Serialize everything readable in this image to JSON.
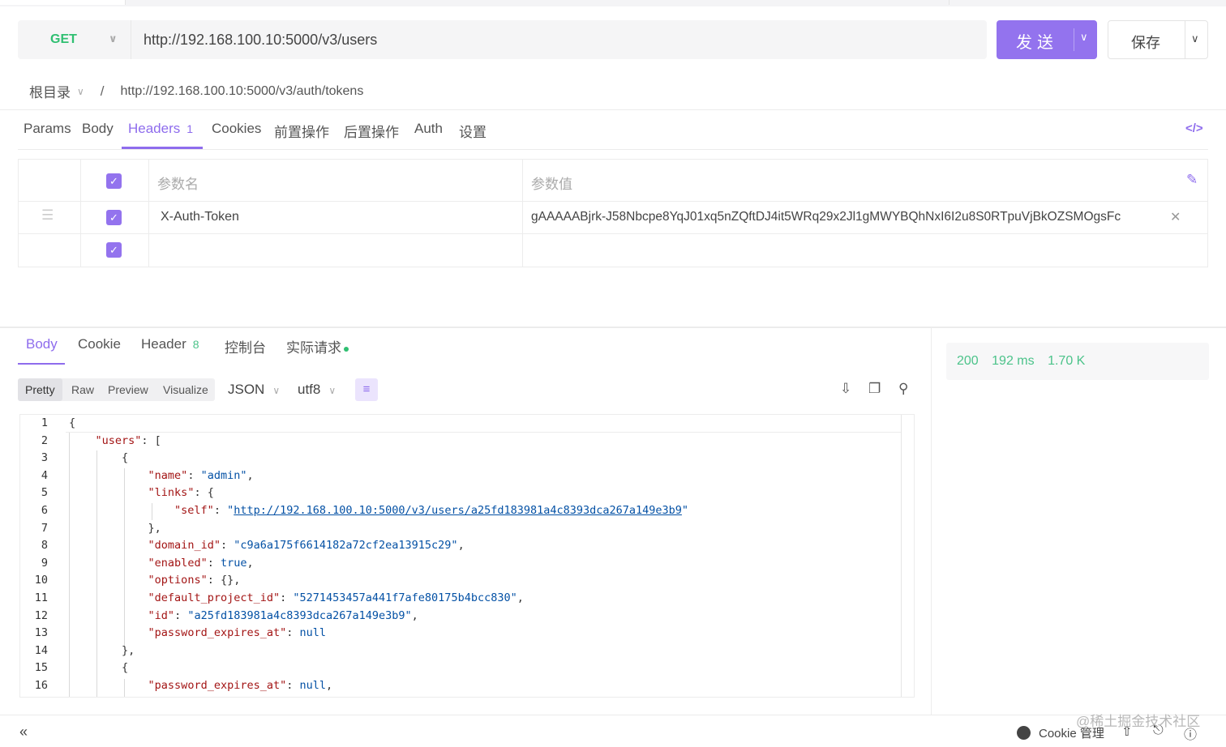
{
  "request": {
    "method": "GET",
    "url": "http://192.168.100.10:5000/v3/users",
    "send_label": "发送",
    "save_label": "保存"
  },
  "breadcrumb": {
    "root": "根目录",
    "separator": "/",
    "path": "http://192.168.100.10:5000/v3/auth/tokens"
  },
  "request_tabs": [
    {
      "label": "Params"
    },
    {
      "label": "Body"
    },
    {
      "label": "Headers",
      "badge": "1"
    },
    {
      "label": "Cookies"
    },
    {
      "label": "前置操作"
    },
    {
      "label": "后置操作"
    },
    {
      "label": "Auth"
    },
    {
      "label": "设置"
    }
  ],
  "headers_table": {
    "name_placeholder": "参数名",
    "value_placeholder": "参数值",
    "rows": [
      {
        "name": "X-Auth-Token",
        "value": "gAAAAABjrk-J58Nbcpe8YqJ01xq5nZQftDJ4it5WRq29x2Jl1gMWYBQhNxI6I2u8S0RTpuVjBkOZSMOgsFc"
      }
    ]
  },
  "response_tabs": [
    {
      "label": "Body"
    },
    {
      "label": "Cookie"
    },
    {
      "label": "Header",
      "badge": "8"
    },
    {
      "label": "控制台"
    },
    {
      "label": "实际请求"
    }
  ],
  "view_modes": [
    "Pretty",
    "Raw",
    "Preview",
    "Visualize"
  ],
  "format": "JSON",
  "encoding": "utf8",
  "status": {
    "code": "200",
    "time": "192 ms",
    "size": "1.70 K"
  },
  "code_lines": [
    {
      "n": "1"
    },
    {
      "n": "2"
    },
    {
      "n": "3"
    },
    {
      "n": "4"
    },
    {
      "n": "5"
    },
    {
      "n": "6"
    },
    {
      "n": "7"
    },
    {
      "n": "8"
    },
    {
      "n": "9"
    },
    {
      "n": "10"
    },
    {
      "n": "11"
    },
    {
      "n": "12"
    },
    {
      "n": "13"
    },
    {
      "n": "14"
    },
    {
      "n": "15"
    },
    {
      "n": "16"
    }
  ],
  "json": {
    "users_key": "\"users\"",
    "name_key": "\"name\"",
    "name_val": "\"admin\"",
    "links_key": "\"links\"",
    "self_key": "\"self\"",
    "self_val": "http://192.168.100.10:5000/v3/users/a25fd183981a4c8393dca267a149e3b9",
    "domain_key": "\"domain_id\"",
    "domain_val": "\"c9a6a175f6614182a72cf2ea13915c29\"",
    "enabled_key": "\"enabled\"",
    "enabled_val": "true",
    "options_key": "\"options\"",
    "options_val": "{}",
    "project_key": "\"default_project_id\"",
    "project_val": "\"5271453457a441f7afe80175b4bcc830\"",
    "id_key": "\"id\"",
    "id_val": "\"a25fd183981a4c8393dca267a149e3b9\"",
    "pw_key": "\"password_expires_at\"",
    "pw_val": "null"
  },
  "footer": {
    "cookie_label": "Cookie 管理",
    "watermark": "@稀土掘金技术社区"
  },
  "colors": {
    "accent": "#9373ee",
    "success": "#2fbf71"
  }
}
